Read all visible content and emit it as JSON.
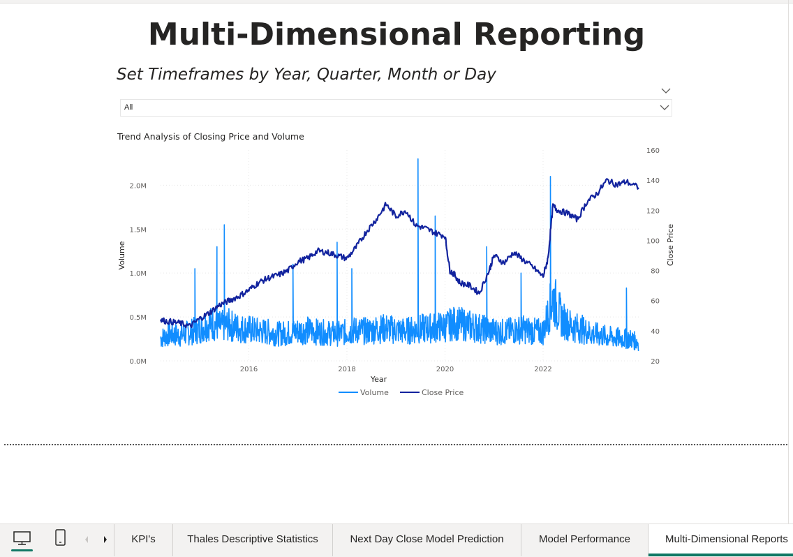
{
  "page": {
    "title": "Multi-Dimensional Reporting",
    "subtitle": "Set Timeframes by Year, Quarter, Month or Day"
  },
  "slicer": {
    "value": "All"
  },
  "chart_data": {
    "type": "line",
    "title": "Trend Analysis of Closing Price and Volume",
    "xlabel": "Year",
    "ylabel_left": "Volume",
    "ylabel_right": "Close Price",
    "x_ticks": [
      "2016",
      "2018",
      "2020",
      "2022"
    ],
    "x_range": [
      2014.2,
      2023.95
    ],
    "y_left_ticks": [
      "0.0M",
      "0.5M",
      "1.0M",
      "1.5M",
      "2.0M"
    ],
    "y_left_range": [
      0,
      2400000
    ],
    "y_right_ticks": [
      "20",
      "40",
      "60",
      "80",
      "100",
      "120",
      "140",
      "160"
    ],
    "y_right_range": [
      20,
      160
    ],
    "grid": true,
    "legend_position": "bottom-center",
    "series": [
      {
        "name": "Volume",
        "axis": "left",
        "color": "#118DFF",
        "x": [
          2014.2,
          2014.4,
          2014.6,
          2014.8,
          2015.0,
          2015.2,
          2015.4,
          2015.6,
          2015.8,
          2016.0,
          2016.2,
          2016.4,
          2016.6,
          2016.8,
          2017.0,
          2017.2,
          2017.4,
          2017.6,
          2017.8,
          2018.0,
          2018.2,
          2018.4,
          2018.6,
          2018.8,
          2019.0,
          2019.2,
          2019.4,
          2019.6,
          2019.8,
          2020.0,
          2020.2,
          2020.4,
          2020.6,
          2020.8,
          2021.0,
          2021.2,
          2021.4,
          2021.6,
          2021.8,
          2022.0,
          2022.2,
          2022.4,
          2022.6,
          2022.8,
          2023.0,
          2023.2,
          2023.4,
          2023.6,
          2023.8,
          2023.95
        ],
        "values": [
          250000,
          300000,
          280000,
          320000,
          350000,
          420000,
          380000,
          400000,
          360000,
          350000,
          330000,
          320000,
          300000,
          310000,
          330000,
          340000,
          320000,
          310000,
          300000,
          320000,
          340000,
          330000,
          350000,
          360000,
          340000,
          330000,
          350000,
          360000,
          370000,
          380000,
          420000,
          400000,
          380000,
          350000,
          330000,
          320000,
          340000,
          350000,
          330000,
          320000,
          700000,
          450000,
          380000,
          350000,
          300000,
          280000,
          260000,
          250000,
          240000,
          200000
        ],
        "spikes": [
          {
            "x": 2015.5,
            "value": 1550000
          },
          {
            "x": 2015.35,
            "value": 1300000
          },
          {
            "x": 2014.9,
            "value": 1050000
          },
          {
            "x": 2016.9,
            "value": 1100000
          },
          {
            "x": 2017.8,
            "value": 1350000
          },
          {
            "x": 2018.1,
            "value": 1050000
          },
          {
            "x": 2019.45,
            "value": 2300000
          },
          {
            "x": 2019.8,
            "value": 1650000
          },
          {
            "x": 2020.85,
            "value": 1300000
          },
          {
            "x": 2021.55,
            "value": 1000000
          },
          {
            "x": 2022.15,
            "value": 2100000
          },
          {
            "x": 2023.7,
            "value": 830000
          }
        ]
      },
      {
        "name": "Close Price",
        "axis": "right",
        "color": "#12239E",
        "x": [
          2014.2,
          2014.4,
          2014.6,
          2014.8,
          2015.0,
          2015.2,
          2015.4,
          2015.6,
          2015.8,
          2016.0,
          2016.2,
          2016.4,
          2016.6,
          2016.8,
          2017.0,
          2017.2,
          2017.4,
          2017.6,
          2017.8,
          2018.0,
          2018.2,
          2018.4,
          2018.6,
          2018.8,
          2019.0,
          2019.2,
          2019.4,
          2019.6,
          2019.8,
          2020.0,
          2020.1,
          2020.2,
          2020.3,
          2020.5,
          2020.7,
          2020.9,
          2021.0,
          2021.2,
          2021.4,
          2021.6,
          2021.8,
          2022.0,
          2022.1,
          2022.2,
          2022.3,
          2022.5,
          2022.7,
          2022.9,
          2023.1,
          2023.3,
          2023.5,
          2023.7,
          2023.95
        ],
        "values": [
          47,
          46,
          45,
          43,
          48,
          52,
          57,
          60,
          63,
          67,
          72,
          75,
          77,
          80,
          86,
          88,
          93,
          92,
          90,
          88,
          96,
          106,
          114,
          124,
          116,
          120,
          110,
          108,
          105,
          103,
          80,
          77,
          72,
          70,
          65,
          80,
          90,
          85,
          92,
          87,
          82,
          76,
          88,
          123,
          120,
          118,
          114,
          126,
          131,
          140,
          137,
          139,
          135
        ]
      }
    ]
  },
  "tabs": {
    "items": [
      {
        "label": "KPI's"
      },
      {
        "label": "Thales Descriptive Statistics"
      },
      {
        "label": "Next Day Close Model Prediction"
      },
      {
        "label": "Model Performance"
      },
      {
        "label": "Multi-Dimensional Reports"
      }
    ],
    "active_index": 4
  },
  "icons": {
    "desktop": "desktop-icon",
    "mobile": "mobile-icon",
    "prev": "chevron-left-icon",
    "next": "chevron-right-icon"
  },
  "colors": {
    "accent": "#117865"
  }
}
